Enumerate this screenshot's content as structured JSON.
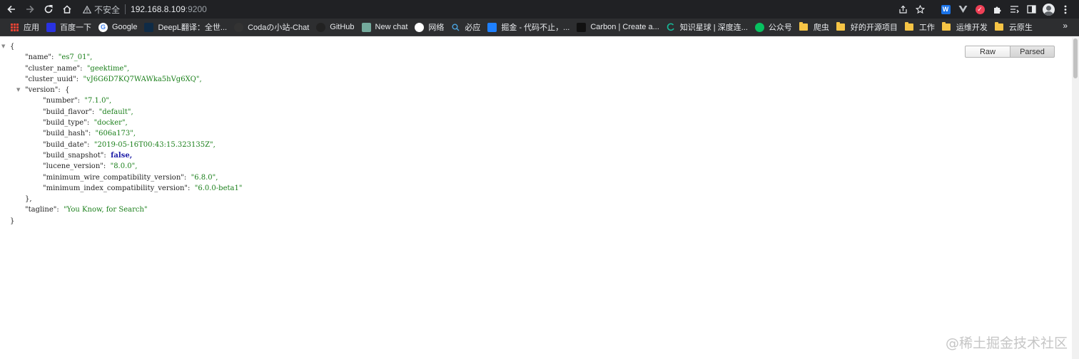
{
  "browser": {
    "security_label": "不安全",
    "url_host": "192.168.8.109",
    "url_port": ":9200"
  },
  "bookmarks": [
    {
      "label": "应用",
      "icon": "apps-grid-icon",
      "color": "#ea4335"
    },
    {
      "label": "百度一下",
      "icon": "baidu-icon",
      "color": "#2932e1"
    },
    {
      "label": "Google",
      "icon": "google-icon",
      "color": "#4285f4"
    },
    {
      "label": "DeepL翻译：全世...",
      "icon": "deepl-icon",
      "color": "#0f2b46"
    },
    {
      "label": "Codaの小站-Chat",
      "icon": "coda-icon",
      "color": "#333333"
    },
    {
      "label": "GitHub",
      "icon": "github-icon",
      "color": "#222222"
    },
    {
      "label": "New chat",
      "icon": "openai-icon",
      "color": "#74aa9c"
    },
    {
      "label": "网络",
      "icon": "panda-icon",
      "color": "#ffffff"
    },
    {
      "label": "必应",
      "icon": "bing-search-icon",
      "color": "#4aa3df"
    },
    {
      "label": "掘金 - 代码不止，...",
      "icon": "juejin-icon",
      "color": "#1e80ff"
    },
    {
      "label": "Carbon | Create a...",
      "icon": "carbon-icon",
      "color": "#111111"
    },
    {
      "label": "知识星球 | 深度连...",
      "icon": "zsxq-icon",
      "color": "#16b998"
    },
    {
      "label": "公众号",
      "icon": "wechat-icon",
      "color": "#07c160"
    },
    {
      "label": "爬虫",
      "icon": "folder-icon",
      "color": "#f6c445"
    },
    {
      "label": "好的开源项目",
      "icon": "folder-icon",
      "color": "#f6c445"
    },
    {
      "label": "工作",
      "icon": "folder-icon",
      "color": "#f6c445"
    },
    {
      "label": "运维开发",
      "icon": "folder-icon",
      "color": "#f6c445"
    },
    {
      "label": "云原生",
      "icon": "folder-icon",
      "color": "#f6c445"
    }
  ],
  "viewer": {
    "raw_label": "Raw",
    "parsed_label": "Parsed"
  },
  "json": {
    "name": {
      "key": "\"name\":",
      "value": "\"es7_01\","
    },
    "cluster_name": {
      "key": "\"cluster_name\":",
      "value": "\"geektime\","
    },
    "cluster_uuid": {
      "key": "\"cluster_uuid\":",
      "value": "\"vJ6G6D7KQ7WAWka5hVg6XQ\","
    },
    "version_key": "\"version\":",
    "version": {
      "number": {
        "key": "\"number\":",
        "value": "\"7.1.0\","
      },
      "build_flavor": {
        "key": "\"build_flavor\":",
        "value": "\"default\","
      },
      "build_type": {
        "key": "\"build_type\":",
        "value": "\"docker\","
      },
      "build_hash": {
        "key": "\"build_hash\":",
        "value": "\"606a173\","
      },
      "build_date": {
        "key": "\"build_date\":",
        "value": "\"2019-05-16T00:43:15.323135Z\","
      },
      "build_snapshot": {
        "key": "\"build_snapshot\":",
        "value": "false,"
      },
      "lucene_version": {
        "key": "\"lucene_version\":",
        "value": "\"8.0.0\","
      },
      "minimum_wire_compatibility_version": {
        "key": "\"minimum_wire_compatibility_version\":",
        "value": "\"6.8.0\","
      },
      "minimum_index_compatibility_version": {
        "key": "\"minimum_index_compatibility_version\":",
        "value": "\"6.0.0-beta1\""
      }
    },
    "tagline": {
      "key": "\"tagline\":",
      "value": "\"You Know, for Search\""
    }
  },
  "watermark": "@稀土掘金技术社区"
}
